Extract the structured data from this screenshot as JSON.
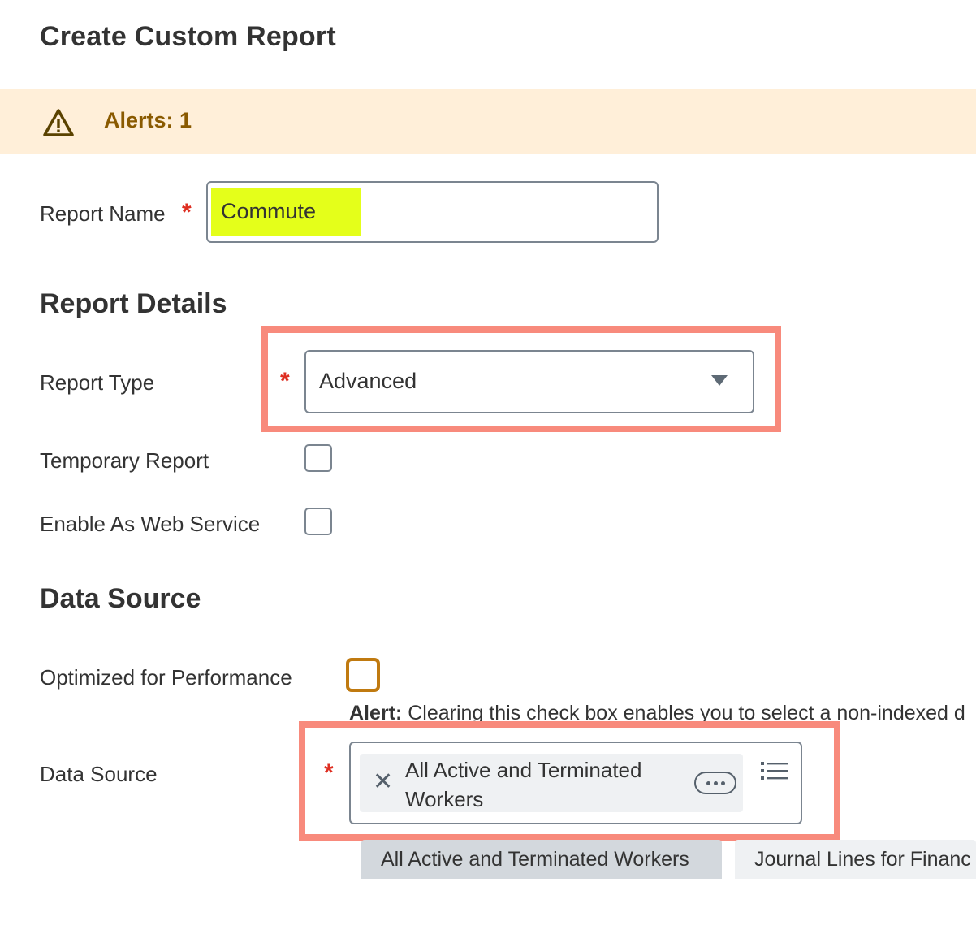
{
  "page": {
    "title": "Create Custom Report"
  },
  "alerts": {
    "label": "Alerts: 1",
    "icon": "warning-triangle-icon",
    "color": "#8a5a00",
    "background": "#ffefd9"
  },
  "report_name": {
    "label": "Report Name",
    "required_mark": "*",
    "value": "Commute"
  },
  "report_details": {
    "heading": "Report Details",
    "report_type": {
      "label": "Report Type",
      "required_mark": "*",
      "value": "Advanced"
    },
    "temporary_report": {
      "label": "Temporary Report",
      "checked": false
    },
    "enable_web_service": {
      "label": "Enable As Web Service",
      "checked": false
    }
  },
  "data_source_section": {
    "heading": "Data Source",
    "optimized": {
      "label": "Optimized for Performance",
      "checked": false
    },
    "alert": {
      "prefix": "Alert:",
      "text": " Clearing this check box enables you to select a non-indexed d"
    },
    "data_source": {
      "label": "Data Source",
      "required_mark": "*",
      "selected_pill": "All Active and Terminated Workers"
    },
    "suggestions": [
      "All Active and Terminated Workers",
      "Journal Lines for Financ"
    ]
  },
  "colors": {
    "required": "#de2e21",
    "focus_outline": "#f88a7c",
    "highlight": "#e4ff1a",
    "warning_checkbox": "#c07a10"
  }
}
